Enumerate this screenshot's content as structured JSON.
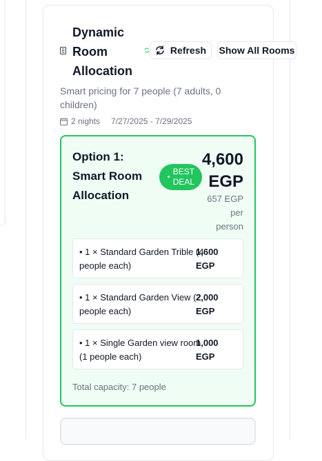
{
  "header": {
    "title": "Dynamic Room Allocation",
    "subtitle": "Smart pricing for 7 people (7 adults, 0 children)",
    "nights": "2 nights",
    "dates": "7/27/2025 - 7/29/2025",
    "refresh_label": "Refresh",
    "show_all_label": "Show All Rooms"
  },
  "option": {
    "title": "Option 1: Smart Room Allocation",
    "badge": "BEST DEAL",
    "price_amount": "4,600",
    "price_currency": "EGP",
    "per_person": "657 EGP per person",
    "rooms": [
      {
        "name": "• 1 × Standard Garden Trible (4 people each)",
        "price": "1,600 EGP"
      },
      {
        "name": "• 1 × Standard Garden View (2 people each)",
        "price": "2,000 EGP"
      },
      {
        "name": "• 1 × Single Garden view room (1 people each)",
        "price": "1,000 EGP"
      }
    ],
    "capacity": "Total capacity: 7 people"
  },
  "colors": {
    "accent_green": "#22c55e",
    "option_bg": "#f0fdf4"
  },
  "icons": {
    "header": "building-icon",
    "sync": "sync-icon",
    "refresh": "refresh-icon",
    "calendar": "calendar-icon",
    "badge": "sparkle-icon"
  }
}
